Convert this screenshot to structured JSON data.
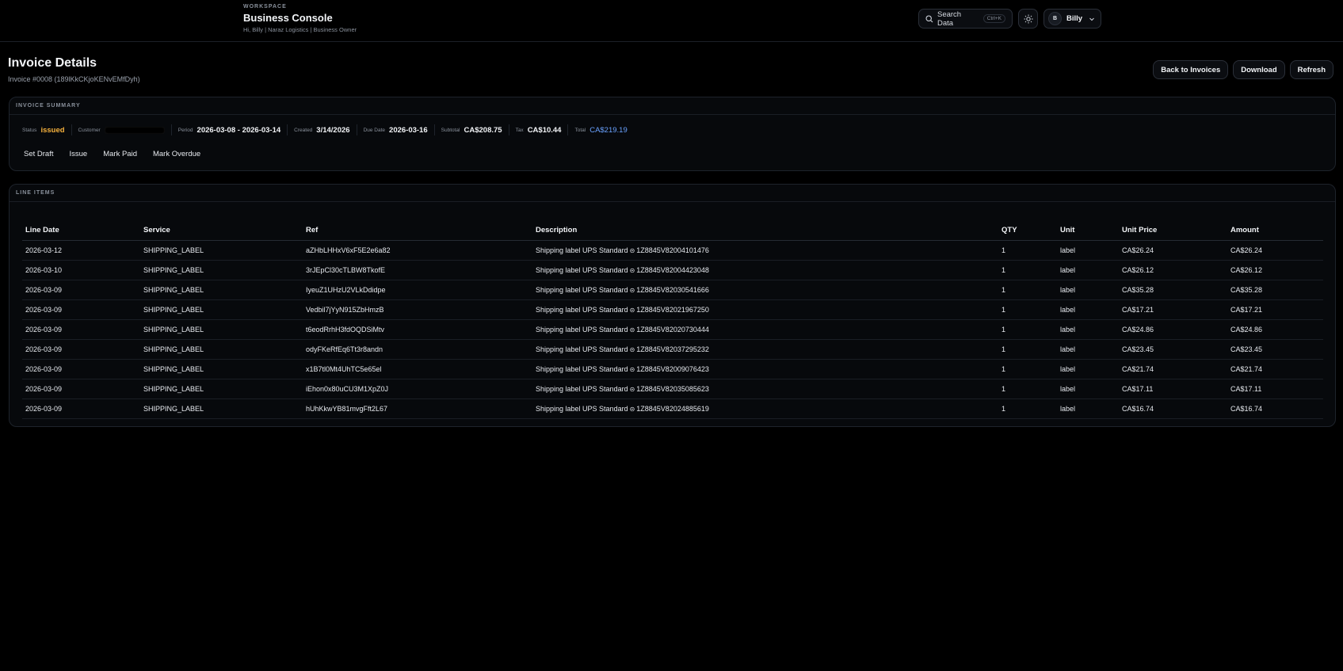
{
  "header": {
    "eyebrow": "WORKSPACE",
    "title": "Business Console",
    "subtitle": "Hi, Billy | Naraz Logistics | Business Owner",
    "search_label": "Search Data",
    "search_shortcut": "Ctrl+K",
    "avatar_initial": "B",
    "user_name": "Billy"
  },
  "page": {
    "title": "Invoice Details",
    "subtitle": "Invoice #0008 (189lKkCKjoKENvEMfDyh)",
    "actions": {
      "back": "Back to Invoices",
      "download": "Download",
      "refresh": "Refresh"
    }
  },
  "summary": {
    "heading": "INVOICE SUMMARY",
    "status_label": "Status",
    "status_value": "issued",
    "customer_label": "Customer",
    "period_label": "Period",
    "period_value": "2026-03-08 - 2026-03-14",
    "created_label": "Created",
    "created_value": "3/14/2026",
    "due_label": "Due Date",
    "due_value": "2026-03-16",
    "subtotal_label": "Subtotal",
    "subtotal_value": "CA$208.75",
    "tax_label": "Tax",
    "tax_value": "CA$10.44",
    "total_label": "Total",
    "total_value": "CA$219.19",
    "actions": {
      "set_draft": "Set Draft",
      "issue": "Issue",
      "mark_paid": "Mark Paid",
      "mark_overdue": "Mark Overdue"
    }
  },
  "line_items": {
    "heading": "LINE ITEMS",
    "columns": [
      "Line Date",
      "Service",
      "Ref",
      "Description",
      "QTY",
      "Unit",
      "Unit Price",
      "Amount"
    ],
    "desc_prefix": "Shipping label UPS Standard",
    "rows": [
      {
        "date": "2026-03-12",
        "service": "SHIPPING_LABEL",
        "ref": "aZHbLHHxV6xF5E2e6a82",
        "tracking": "1Z8845V82004101476",
        "qty": "1",
        "unit": "label",
        "unit_price": "CA$26.24",
        "amount": "CA$26.24"
      },
      {
        "date": "2026-03-10",
        "service": "SHIPPING_LABEL",
        "ref": "3rJEpCl30cTLBW8TkofE",
        "tracking": "1Z8845V82004423048",
        "qty": "1",
        "unit": "label",
        "unit_price": "CA$26.12",
        "amount": "CA$26.12"
      },
      {
        "date": "2026-03-09",
        "service": "SHIPPING_LABEL",
        "ref": "IyeuZ1UHzU2VLkDdidpe",
        "tracking": "1Z8845V82030541666",
        "qty": "1",
        "unit": "label",
        "unit_price": "CA$35.28",
        "amount": "CA$35.28"
      },
      {
        "date": "2026-03-09",
        "service": "SHIPPING_LABEL",
        "ref": "Vedbil7jYyN915ZbHmzB",
        "tracking": "1Z8845V82021967250",
        "qty": "1",
        "unit": "label",
        "unit_price": "CA$17.21",
        "amount": "CA$17.21"
      },
      {
        "date": "2026-03-09",
        "service": "SHIPPING_LABEL",
        "ref": "t6eodRrhH3fdOQDSiMtv",
        "tracking": "1Z8845V82020730444",
        "qty": "1",
        "unit": "label",
        "unit_price": "CA$24.86",
        "amount": "CA$24.86"
      },
      {
        "date": "2026-03-09",
        "service": "SHIPPING_LABEL",
        "ref": "odyFKeRfEq6Tt3r8andn",
        "tracking": "1Z8845V82037295232",
        "qty": "1",
        "unit": "label",
        "unit_price": "CA$23.45",
        "amount": "CA$23.45"
      },
      {
        "date": "2026-03-09",
        "service": "SHIPPING_LABEL",
        "ref": "x1B7tl0Mt4UhTC5e65el",
        "tracking": "1Z8845V82009076423",
        "qty": "1",
        "unit": "label",
        "unit_price": "CA$21.74",
        "amount": "CA$21.74"
      },
      {
        "date": "2026-03-09",
        "service": "SHIPPING_LABEL",
        "ref": "iEhon0x80uCU3M1XpZ0J",
        "tracking": "1Z8845V82035085623",
        "qty": "1",
        "unit": "label",
        "unit_price": "CA$17.11",
        "amount": "CA$17.11"
      },
      {
        "date": "2026-03-09",
        "service": "SHIPPING_LABEL",
        "ref": "hUhKkwYB81mvgFft2L67",
        "tracking": "1Z8845V82024885619",
        "qty": "1",
        "unit": "label",
        "unit_price": "CA$16.74",
        "amount": "CA$16.74"
      }
    ]
  },
  "colors": {
    "status_issued": "#f5b13d",
    "total_accent": "#6aa2ff"
  }
}
